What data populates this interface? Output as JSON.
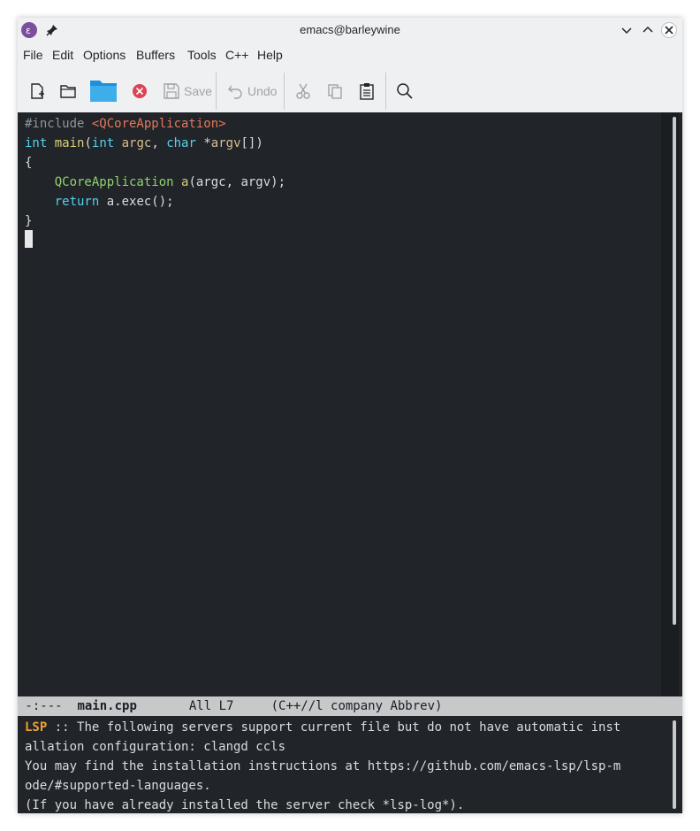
{
  "window": {
    "title": "emacs@barleywine"
  },
  "menu": {
    "items": [
      "File",
      "Edit",
      "Options",
      "Buffers",
      "Tools",
      "C++",
      "Help"
    ]
  },
  "toolbar": {
    "save_label": "Save",
    "undo_label": "Undo"
  },
  "editor": {
    "line1": {
      "pre": "#include ",
      "inc": "<QCoreApplication>"
    },
    "line2": {
      "t1": "int",
      "sp1": " ",
      "fn": "main",
      "p1": "(",
      "t2": "int",
      "sp2": " ",
      "v1": "argc",
      "c1": ", ",
      "t3": "char",
      "sp3": " *",
      "v2": "argv",
      "p2": "[])"
    },
    "line3": "{",
    "line4": {
      "indent": "    ",
      "cls": "QCoreApplication",
      "sp": " ",
      "fn": "a",
      "rest": "(argc, argv);"
    },
    "line5": {
      "indent": "    ",
      "kw": "return",
      "rest": " a.exec();"
    },
    "line6": "}"
  },
  "modeline": {
    "status": " -:---  ",
    "buffer": "main.cpp",
    "position": "       All L7     ",
    "modes": "(C++//l company Abbrev)"
  },
  "echo": {
    "lsp": "LSP",
    "line1": " :: The following servers support current file but do not have automatic inst",
    "line2": "allation configuration: clangd ccls",
    "line3": "You may find the installation instructions at https://github.com/emacs-lsp/lsp-m",
    "line4": "ode/#supported-languages.",
    "line5": "(If you have already installed the server check *lsp-log*)."
  },
  "colors": {
    "editor_bg": "#212428",
    "modeline_bg": "#c6c8ca",
    "lsp_accent": "#f0a030"
  }
}
